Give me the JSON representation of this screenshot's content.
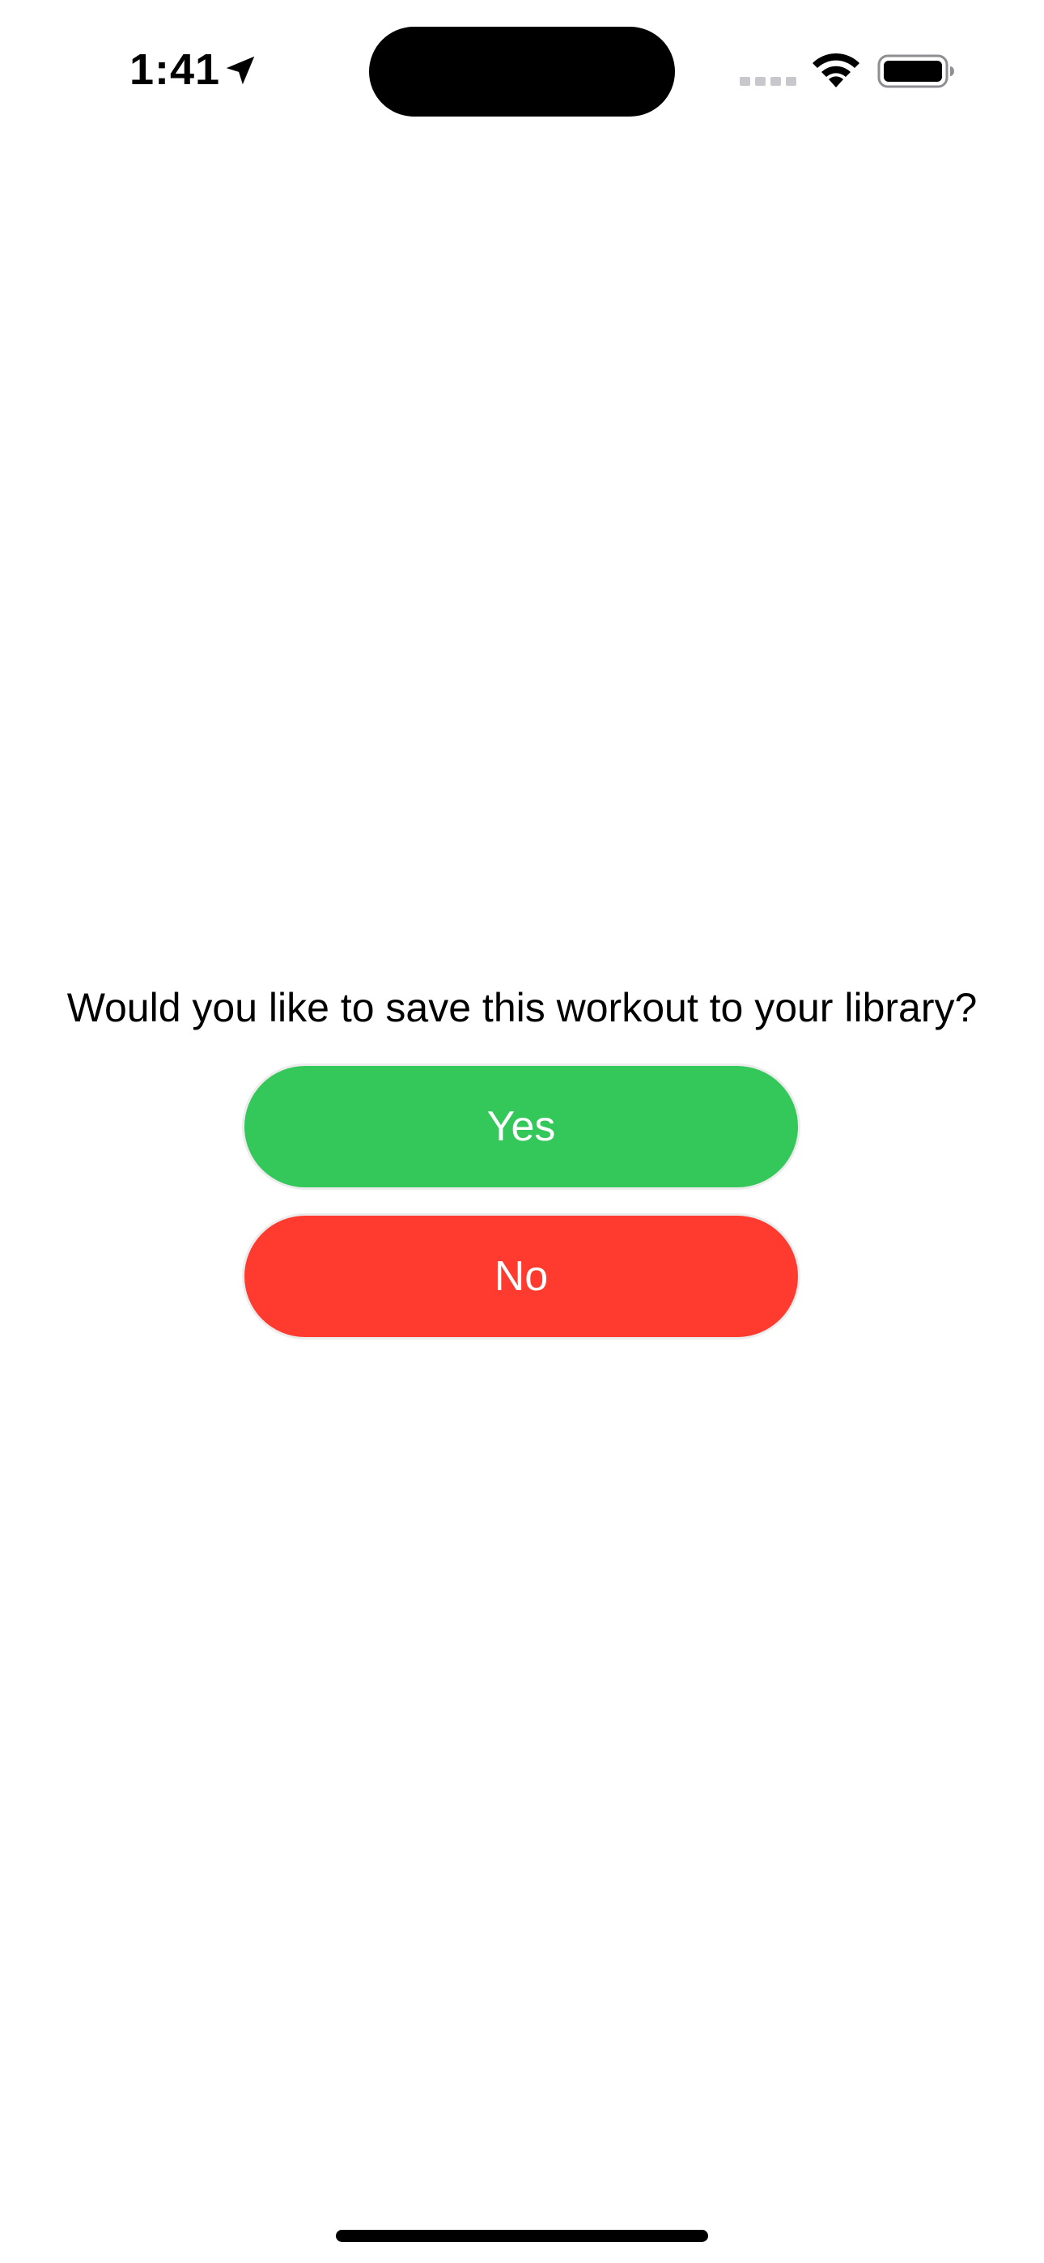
{
  "status_bar": {
    "time": "1:41",
    "icons": [
      "location-arrow-icon",
      "cellular-signal-icon",
      "wifi-icon",
      "battery-icon"
    ]
  },
  "dialog": {
    "prompt": "Would you like to save this workout to your library?",
    "yes_label": "Yes",
    "no_label": "No"
  },
  "colors": {
    "yes_button": "#34c759",
    "no_button": "#ff3b30",
    "background": "#ffffff"
  }
}
